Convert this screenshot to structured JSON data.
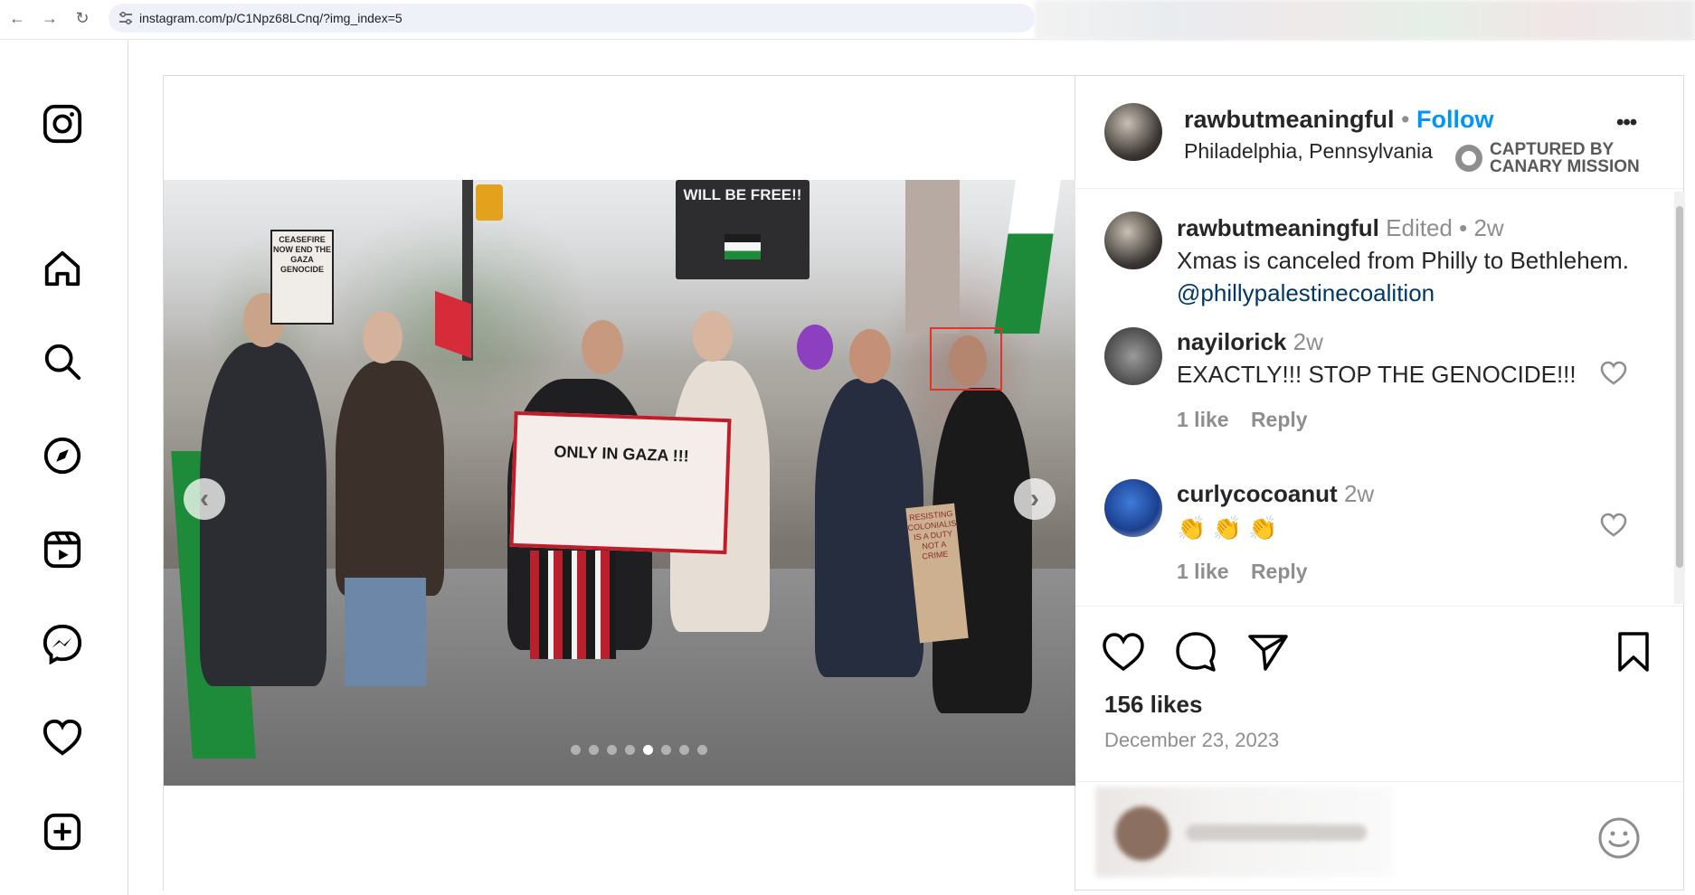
{
  "browser": {
    "url": "instagram.com/p/C1Npz68LCnq/?img_index=5",
    "back_icon": "back-arrow-icon",
    "forward_icon": "forward-arrow-icon",
    "reload_icon": "reload-icon"
  },
  "sidebar": {
    "items": [
      {
        "name": "instagram-logo-icon"
      },
      {
        "name": "home-icon"
      },
      {
        "name": "search-icon"
      },
      {
        "name": "explore-icon"
      },
      {
        "name": "reels-icon"
      },
      {
        "name": "messenger-icon"
      },
      {
        "name": "notifications-heart-icon"
      },
      {
        "name": "create-plus-icon"
      }
    ]
  },
  "carousel": {
    "current_index": 5,
    "total": 8,
    "sign_text": "WILL BE FREE!!",
    "poster_text": "ONLY IN GAZA !!!",
    "left_sign": "CEASEFIRE NOW END THE GAZA GENOCIDE",
    "right_sign": "RESISTING COLONIALISM IS A DUTY NOT A CRIME"
  },
  "post": {
    "author": "rawbutmeaningful",
    "follow_label": "Follow",
    "separator": "•",
    "location": "Philadelphia, Pennsylvania",
    "badge_line1": "CAPTURED BY",
    "badge_line2": "CANARY MISSION",
    "more_label": "•••",
    "caption": {
      "user": "rawbutmeaningful",
      "edited": "Edited",
      "time": "2w",
      "text": "Xmas is canceled from Philly to Bethlehem.",
      "mention": "@phillypalestinecoalition"
    },
    "comments": [
      {
        "user": "nayilorick",
        "time": "2w",
        "text": "EXACTLY!!! STOP THE GENOCIDE!!!",
        "likes": "1 like",
        "reply": "Reply"
      },
      {
        "user": "curlycocoanut",
        "time": "2w",
        "text": "👏 👏 👏",
        "likes": "1 like",
        "reply": "Reply"
      }
    ],
    "likes": "156 likes",
    "date": "December 23, 2023"
  },
  "colors": {
    "accent": "#0095f6",
    "text": "#262626",
    "muted": "#8e8e8e",
    "highlight_box": "#e0332b"
  }
}
